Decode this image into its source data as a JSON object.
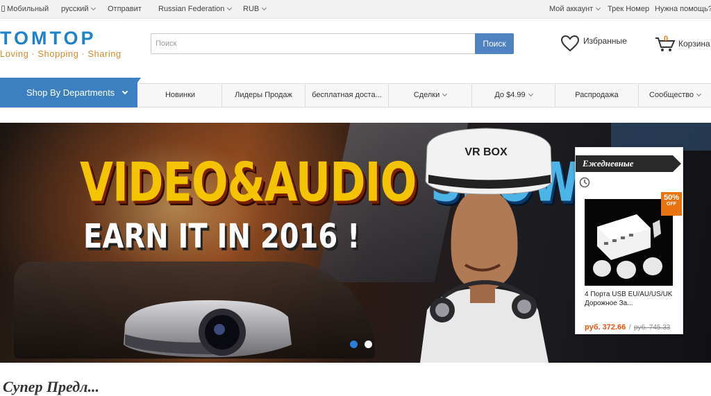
{
  "topbar": {
    "mobile": "Мобильный",
    "language": "русский",
    "ship_to": "Отправит",
    "country": "Russian Federation",
    "currency": "RUB",
    "account": "Мой аккаунт",
    "track": "Трек Номер",
    "help": "Нужна помощь?"
  },
  "logo": {
    "name": "TOMTOP",
    "tagline": "Loving · Shopping · Sharing"
  },
  "search": {
    "placeholder": "Поиск",
    "button": "Поиск"
  },
  "favorites": {
    "label": "Избранные",
    "icon": "heart-icon"
  },
  "cart": {
    "label": "Корзина",
    "count": "0",
    "icon": "cart-icon"
  },
  "nav": {
    "departments": "Shop By Departments",
    "items": [
      {
        "label": "Новинки",
        "dropdown": false
      },
      {
        "label": "Лидеры Продаж",
        "dropdown": false
      },
      {
        "label": "бесплатная доста...",
        "dropdown": false
      },
      {
        "label": "Сделки",
        "dropdown": true
      },
      {
        "label": "До $4.99",
        "dropdown": true
      },
      {
        "label": "Распродажа",
        "dropdown": false
      },
      {
        "label": "Сообщество",
        "dropdown": true
      }
    ]
  },
  "banner": {
    "headline_part1": "VIDEO&AUDIO ",
    "headline_part2": "SHOW",
    "subline": "EARN IT IN 2016 !",
    "vr_label": "VR BOX",
    "active_slide": 1,
    "slide_count": 2,
    "colors": {
      "active_dot": "#2a7fd4",
      "inactive_dot": "#ffffff"
    }
  },
  "deal": {
    "header": "Ежедневные",
    "discount": "50%",
    "discount_off": "OFF",
    "product_name": "4 Порта USB EU/AU/US/UK Дорожное За...",
    "price": "руб. 372.66",
    "separator": "/",
    "old_price": "руб. 745.33"
  },
  "section": {
    "title": "Супер Предл..."
  },
  "colors": {
    "brand_blue": "#1e82c8",
    "accent_orange": "#e8730f",
    "nav_blue": "#3d80c2",
    "search_button": "#4f82be"
  }
}
